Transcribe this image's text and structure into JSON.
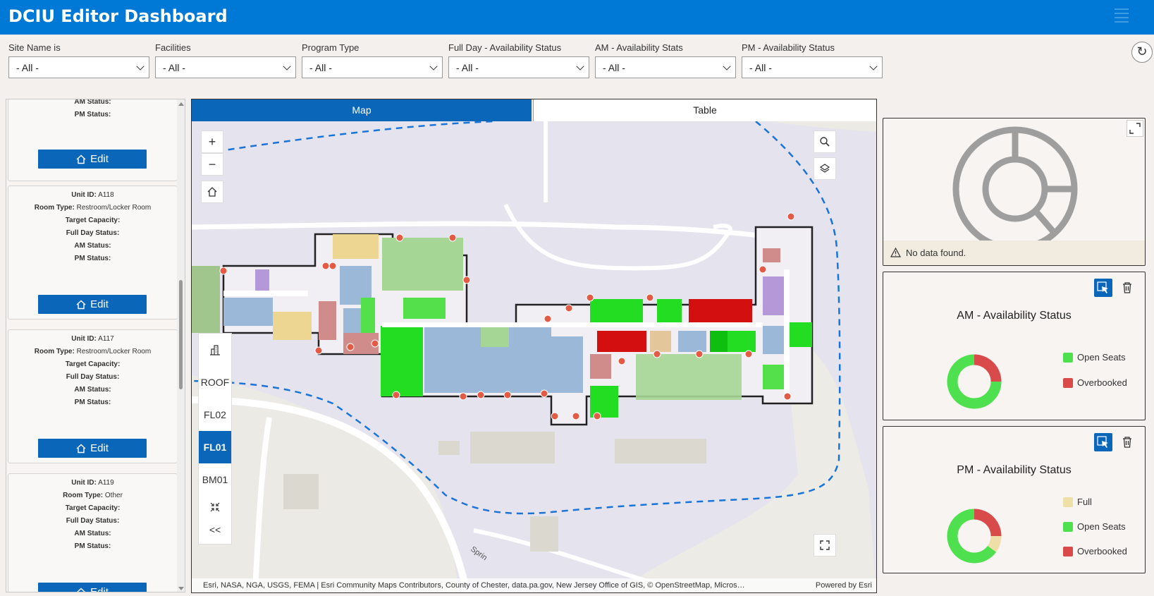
{
  "app": {
    "title": "DCIU Editor Dashboard"
  },
  "filters": [
    {
      "label": "Site Name is",
      "value": "- All -"
    },
    {
      "label": "Facilities",
      "value": "- All -"
    },
    {
      "label": "Program Type",
      "value": "- All -"
    },
    {
      "label": "Full Day - Availability Status",
      "value": "- All -"
    },
    {
      "label": "AM - Availability Stats",
      "value": "- All -"
    },
    {
      "label": "PM - Availability Status",
      "value": "- All -"
    }
  ],
  "list": {
    "edit_label": "Edit",
    "labels": {
      "unit_id": "Unit ID:",
      "room_type": "Room Type:",
      "target_capacity": "Target Capacity:",
      "full_day": "Full Day Status:",
      "am": "AM Status:",
      "pm": "PM Status:"
    },
    "cards": [
      {
        "unit_id": "",
        "room_type": ""
      },
      {
        "unit_id": "A118",
        "room_type": "Restroom/Locker Room"
      },
      {
        "unit_id": "A117",
        "room_type": "Restroom/Locker Room"
      },
      {
        "unit_id": "A119",
        "room_type": "Other"
      }
    ]
  },
  "map": {
    "tabs": {
      "map": "Map",
      "table": "Table"
    },
    "zoom_in": "+",
    "zoom_out": "−",
    "floors": [
      "ROOF",
      "FL02",
      "FL01",
      "BM01"
    ],
    "active_floor": "FL01",
    "collapse": "<<",
    "attribution": "Esri, NASA, NGA, USGS, FEMA | Esri Community Maps Contributors, County of Chester, data.pa.gov, New Jersey Office of GIS, © OpenStreetMap, Micros…",
    "powered": "Powered by Esri",
    "road_label": "Sprin"
  },
  "widgets": {
    "nodata": {
      "message": "No data found."
    },
    "am": {
      "title": "AM - Availability Status",
      "legend": [
        {
          "label": "Open Seats",
          "color": "#4ee04e"
        },
        {
          "label": "Overbooked",
          "color": "#d94a4a"
        }
      ]
    },
    "pm": {
      "title": "PM - Availability Status",
      "legend": [
        {
          "label": "Full",
          "color": "#eedfa8"
        },
        {
          "label": "Open Seats",
          "color": "#4ee04e"
        },
        {
          "label": "Overbooked",
          "color": "#d94a4a"
        }
      ]
    }
  },
  "chart_data": [
    {
      "type": "pie",
      "title": "AM - Availability Status",
      "categories": [
        "Open Seats",
        "Overbooked"
      ],
      "values": [
        0.75,
        0.25
      ]
    },
    {
      "type": "pie",
      "title": "PM - Availability Status",
      "categories": [
        "Full",
        "Open Seats",
        "Overbooked"
      ],
      "values": [
        0.1,
        0.65,
        0.25
      ]
    }
  ]
}
